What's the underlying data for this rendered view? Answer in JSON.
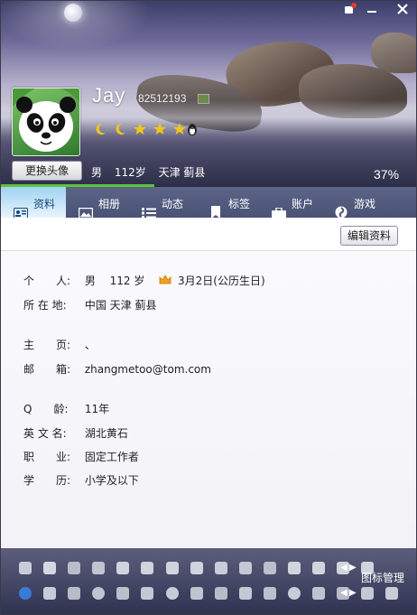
{
  "window": {
    "controls": [
      "skin",
      "minimize",
      "restore",
      "close"
    ]
  },
  "profile": {
    "nickname": "Jay",
    "qq_number": "82512193",
    "change_avatar_label": "更换头像",
    "gender": "男",
    "age": "112岁",
    "location": "天津 蓟县",
    "completion": "37%",
    "completion_value": 0.37
  },
  "tabs": [
    {
      "label": "资料",
      "icon": "profile-card-icon",
      "active": true
    },
    {
      "label": "相册",
      "icon": "photo-album-icon",
      "active": false
    },
    {
      "label": "动态",
      "icon": "list-icon",
      "active": false
    },
    {
      "label": "标签",
      "icon": "bookmark-icon",
      "active": false
    },
    {
      "label": "账户",
      "icon": "briefcase-icon",
      "active": false
    },
    {
      "label": "游戏",
      "icon": "game-icon",
      "active": false
    }
  ],
  "content": {
    "edit_button": "编辑资料",
    "fields": [
      {
        "label": "个　　人:",
        "value": "男　 112 岁"
      },
      {
        "label": "所 在 地:",
        "value": "中国 天津 蓟县"
      },
      {
        "label": "主　　页:",
        "value": "、"
      },
      {
        "label": "邮　　箱:",
        "value": "zhangmetoo@tom.com"
      },
      {
        "label": "Q　　龄:",
        "value": "11年"
      },
      {
        "label": "英 文 名:",
        "value": "湖北黄石"
      },
      {
        "label": "职　　业:",
        "value": "固定工作者"
      },
      {
        "label": "学　　历:",
        "value": "小学及以下"
      }
    ],
    "birthday": "3月2日(公历生日)"
  },
  "footer": {
    "icon_manager": "图标管理"
  },
  "colors": {
    "tab_bar": "#4f587a",
    "tab_active": "#bfe2f7",
    "progress": "#5fc23a",
    "footer": "#3e405e"
  }
}
